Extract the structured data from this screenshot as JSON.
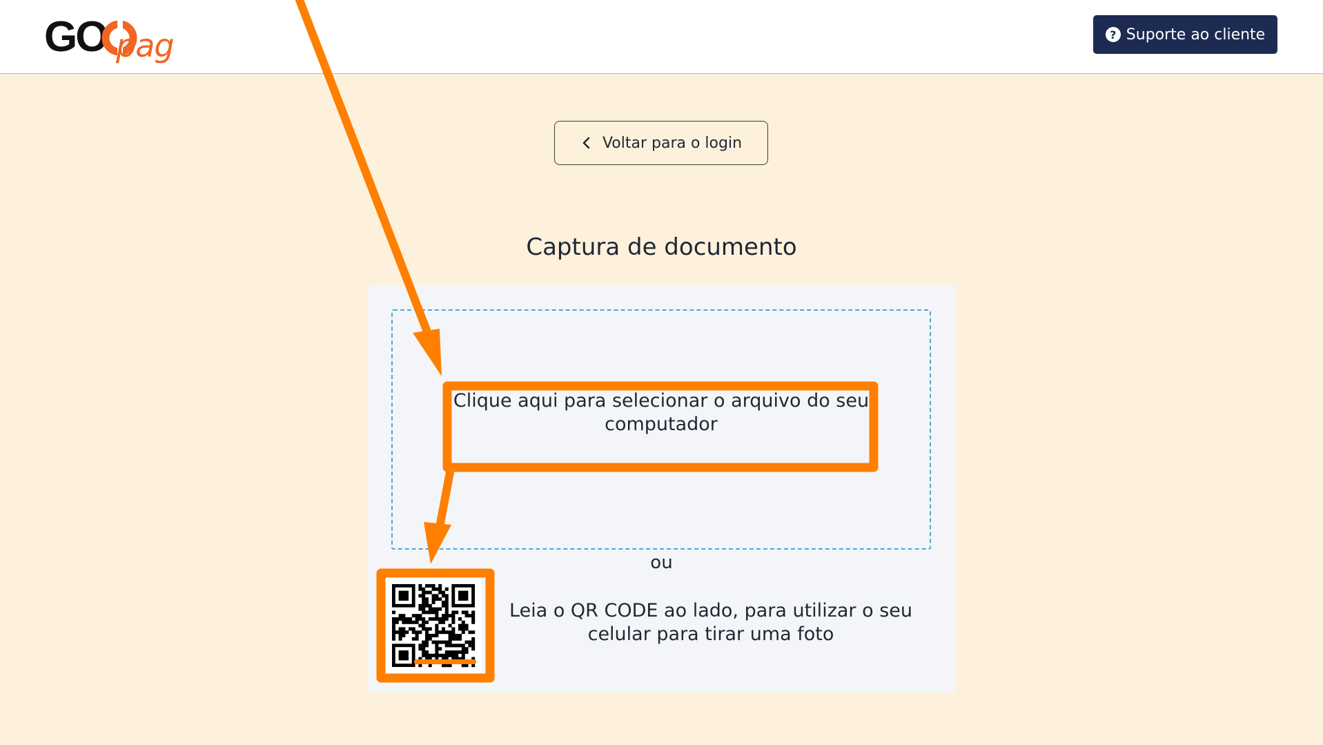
{
  "header": {
    "logo": {
      "text_go": "GO",
      "text_pag": "pag",
      "brand_color": "#f26522"
    },
    "support_button": {
      "label": "Suporte ao cliente",
      "icon": "question-circle-icon",
      "bg_color": "#1d2b53"
    }
  },
  "main": {
    "back_button": {
      "label": "Voltar para o login",
      "icon": "chevron-left-icon"
    },
    "title": "Captura de documento",
    "upload": {
      "text": "Clique aqui para selecionar o arquivo do seu computador"
    },
    "separator": "ou",
    "qr": {
      "icon": "qr-code-icon",
      "text": "Leia o QR CODE ao lado, para utilizar o seu celular para tirar uma foto"
    }
  },
  "annotations": {
    "highlight_color": "#ff7f00"
  }
}
